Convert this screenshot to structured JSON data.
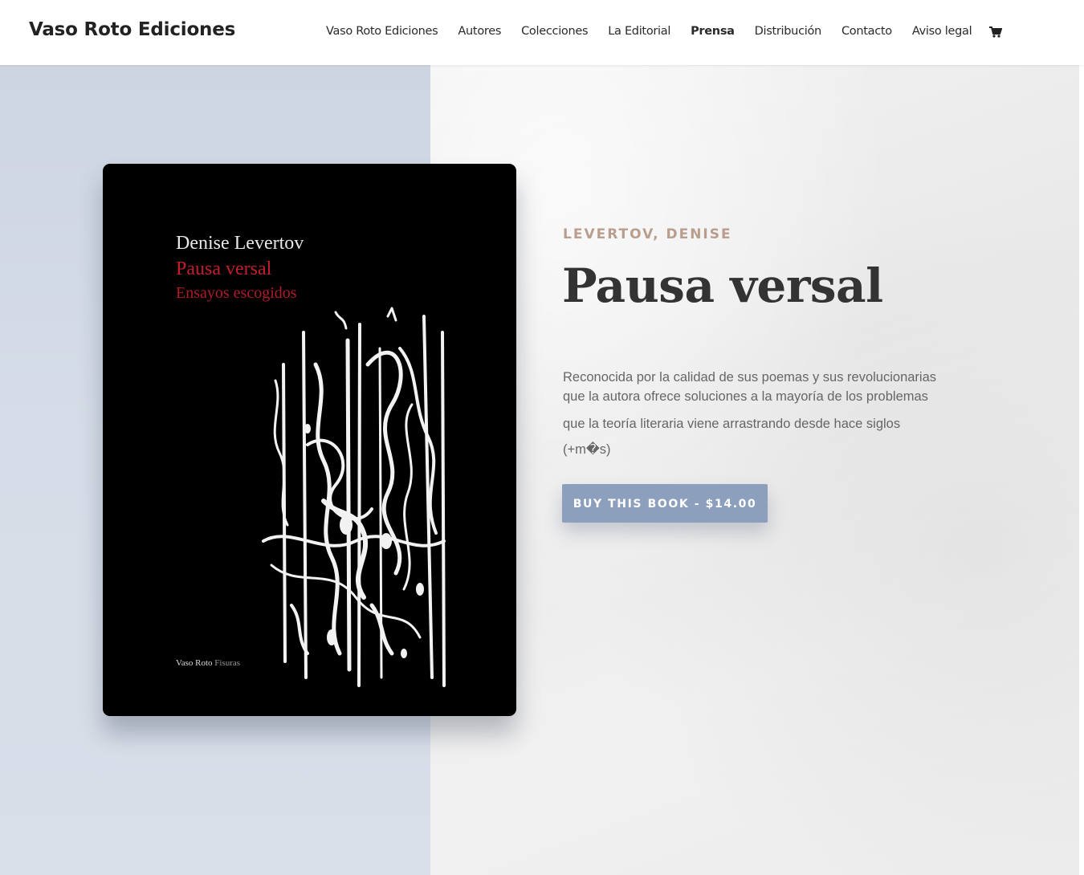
{
  "header": {
    "site_title": "Vaso Roto Ediciones",
    "nav": [
      {
        "label": "Vaso Roto Ediciones",
        "active": false
      },
      {
        "label": "Autores",
        "active": false
      },
      {
        "label": "Colecciones",
        "active": false
      },
      {
        "label": "La Editorial",
        "active": false
      },
      {
        "label": "Prensa",
        "active": true
      },
      {
        "label": "Distribución",
        "active": false
      },
      {
        "label": "Contacto",
        "active": false
      },
      {
        "label": "Aviso legal",
        "active": false
      }
    ],
    "cart_icon": "shopping-cart-icon"
  },
  "book": {
    "cover": {
      "author": "Denise Levertov",
      "title": "Pausa versal",
      "subtitle": "Ensayos escogidos",
      "imprint": "Vaso Roto",
      "series": "Fisuras"
    },
    "author": "LEVERTOV, DENISE",
    "title": "Pausa versal",
    "description": [
      "Reconocida por la calidad de sus poemas y sus revolucionarias",
      "que la autora ofrece soluciones a la mayoría de los problemas",
      "que la teoría literaria viene arrastrando desde hace siglos",
      "(+m�s)"
    ],
    "buy_button": "BUY THIS BOOK - $14.00"
  },
  "colors": {
    "accent_button": "#8c9fbd",
    "author_line": "#b99d8d",
    "cover_title_red": "#c41e2e",
    "left_panel": "#d6dde8"
  }
}
